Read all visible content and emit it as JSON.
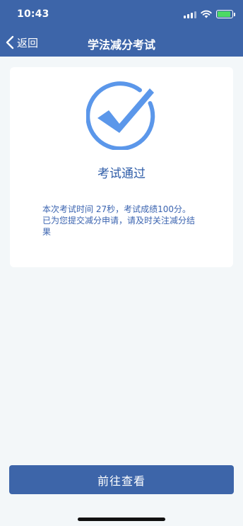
{
  "status_bar": {
    "time": "10:43"
  },
  "nav": {
    "back_label": "返回",
    "title": "学法减分考试"
  },
  "result": {
    "title": "考试通过",
    "description": "本次考试时间 27秒，考试成绩100分。已为您提交减分申请，请及时关注减分结果"
  },
  "action": {
    "button_label": "前往查看"
  },
  "colors": {
    "header_bg": "#3d65a9",
    "accent_blue": "#5b97ea",
    "text_blue": "#2f5da8",
    "page_bg": "#f3f7f9",
    "battery_green": "#4cd964"
  }
}
